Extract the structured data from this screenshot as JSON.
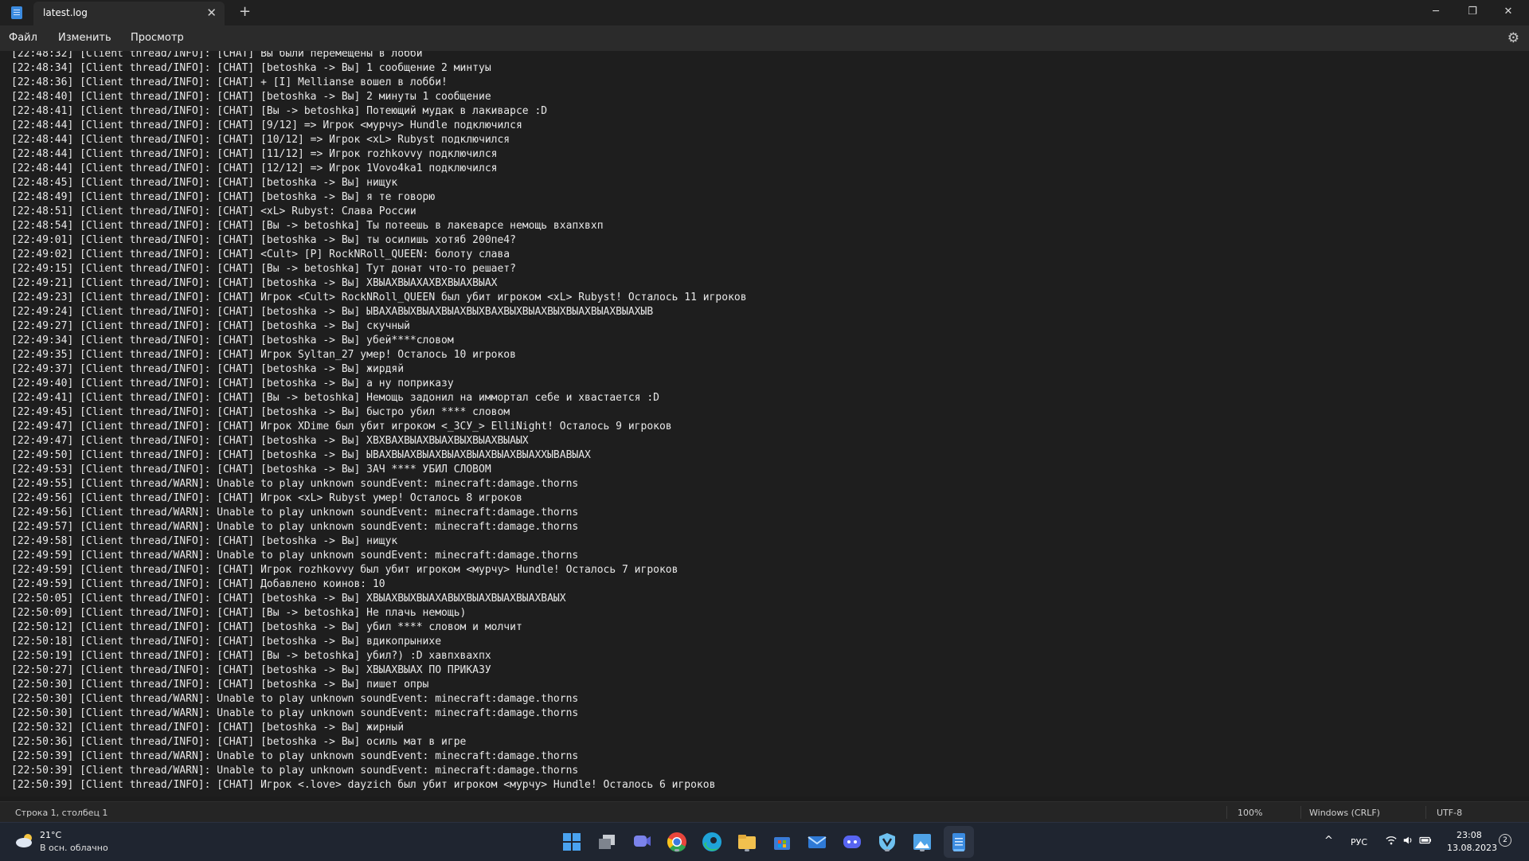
{
  "window": {
    "tab_title": "latest.log",
    "close_tab_glyph": "✕",
    "new_tab_glyph": "+",
    "minimize_glyph": "─",
    "restore_glyph": "❐",
    "close_glyph": "✕"
  },
  "menu": {
    "file": "Файл",
    "edit": "Изменить",
    "view": "Просмотр",
    "settings_icon": "gear-icon"
  },
  "log_lines": [
    "[22:48:32] [Client thread/INFO]: [CHAT] Вы были перемещены в лобби",
    "[22:48:34] [Client thread/INFO]: [CHAT] [betoshka -> Вы] 1 сообщение 2 минтуы",
    "[22:48:36] [Client thread/INFO]: [CHAT] + [I] Mellianse вошел в лобби!",
    "[22:48:40] [Client thread/INFO]: [CHAT] [betoshka -> Вы] 2 минуты 1 сообщение",
    "[22:48:41] [Client thread/INFO]: [CHAT] [Вы -> betoshka] Потеющий мудак в лакиварсе :D",
    "[22:48:44] [Client thread/INFO]: [CHAT] [9/12] => Игрок <мурчу> Hundle подключился",
    "[22:48:44] [Client thread/INFO]: [CHAT] [10/12] => Игрок <xL> Rubyst подключился",
    "[22:48:44] [Client thread/INFO]: [CHAT] [11/12] => Игрок rozhkovvy подключился",
    "[22:48:44] [Client thread/INFO]: [CHAT] [12/12] => Игрок 1Vovo4ka1 подключился",
    "[22:48:45] [Client thread/INFO]: [CHAT] [betoshka -> Вы] нищук",
    "[22:48:49] [Client thread/INFO]: [CHAT] [betoshka -> Вы] я те говорю",
    "[22:48:51] [Client thread/INFO]: [CHAT] <xL> Rubyst: Слава России",
    "[22:48:54] [Client thread/INFO]: [CHAT] [Вы -> betoshka] Ты потеешь в лакеварсе немощь вхапхвхп",
    "[22:49:01] [Client thread/INFO]: [CHAT] [betoshka -> Вы] ты осилишь хотяб 200пе4?",
    "[22:49:02] [Client thread/INFO]: [CHAT] <Cult> [P] RockNRoll_QUEEN: болоту слава",
    "[22:49:15] [Client thread/INFO]: [CHAT] [Вы -> betoshka] Тут донат что-то решает?",
    "[22:49:21] [Client thread/INFO]: [CHAT] [betoshka -> Вы] ХВЫАХВЫАХАХВХВЫАХВЫАХ",
    "[22:49:23] [Client thread/INFO]: [CHAT] Игрок <Cult> RockNRoll_QUEEN был убит игроком <xL> Rubyst! Осталось 11 игроков",
    "[22:49:24] [Client thread/INFO]: [CHAT] [betoshka -> Вы] ЫВАХАВЫХВЫАХВЫАХВЫХВАХВЫХВЫАХВЫХВЫАХВЫАХВЫАХЫВ",
    "[22:49:27] [Client thread/INFO]: [CHAT] [betoshka -> Вы] скучный",
    "[22:49:34] [Client thread/INFO]: [CHAT] [betoshka -> Вы] убей****словом",
    "[22:49:35] [Client thread/INFO]: [CHAT] Игрок Syltan_27 умер! Осталось 10 игроков",
    "[22:49:37] [Client thread/INFO]: [CHAT] [betoshka -> Вы] жирдяй",
    "[22:49:40] [Client thread/INFO]: [CHAT] [betoshka -> Вы] а ну поприказу",
    "[22:49:41] [Client thread/INFO]: [CHAT] [Вы -> betoshka] Немощь задонил на иммортал себе и хвастается :D",
    "[22:49:45] [Client thread/INFO]: [CHAT] [betoshka -> Вы] быстро убил **** словом",
    "[22:49:47] [Client thread/INFO]: [CHAT] Игрок XDime был убит игроком <_ЗСУ_> ElliNight! Осталось 9 игроков",
    "[22:49:47] [Client thread/INFO]: [CHAT] [betoshka -> Вы] ХВХВАХВЫАХВЫАХВЫХВЫАХВЫАЫХ",
    "[22:49:50] [Client thread/INFO]: [CHAT] [betoshka -> Вы] ЫВАХВЫАХВЫАХВЫАХВЫАХВЫАХВЫАХХЫВАВЫАХ",
    "[22:49:53] [Client thread/INFO]: [CHAT] [betoshka -> Вы] ЗАЧ **** УБИЛ СЛОВОМ",
    "[22:49:55] [Client thread/WARN]: Unable to play unknown soundEvent: minecraft:damage.thorns",
    "[22:49:56] [Client thread/INFO]: [CHAT] Игрок <xL> Rubyst умер! Осталось 8 игроков",
    "[22:49:56] [Client thread/WARN]: Unable to play unknown soundEvent: minecraft:damage.thorns",
    "[22:49:57] [Client thread/WARN]: Unable to play unknown soundEvent: minecraft:damage.thorns",
    "[22:49:58] [Client thread/INFO]: [CHAT] [betoshka -> Вы] нищук",
    "[22:49:59] [Client thread/WARN]: Unable to play unknown soundEvent: minecraft:damage.thorns",
    "[22:49:59] [Client thread/INFO]: [CHAT] Игрок rozhkovvy был убит игроком <мурчу> Hundle! Осталось 7 игроков",
    "[22:49:59] [Client thread/INFO]: [CHAT] Добавлено коинов: 10",
    "[22:50:05] [Client thread/INFO]: [CHAT] [betoshka -> Вы] ХВЫАХВЫХВЫАХАВЫХВЫАХВЫАХВЫАХВАЫХ",
    "[22:50:09] [Client thread/INFO]: [CHAT] [Вы -> betoshka] Не плачь немощь)",
    "[22:50:12] [Client thread/INFO]: [CHAT] [betoshka -> Вы] убил **** словом и молчит",
    "[22:50:18] [Client thread/INFO]: [CHAT] [betoshka -> Вы] вдикопрынихе",
    "[22:50:19] [Client thread/INFO]: [CHAT] [Вы -> betoshka] убил?) :D хавпхвахпх",
    "[22:50:27] [Client thread/INFO]: [CHAT] [betoshka -> Вы] ХВЫАХВЫАХ ПО ПРИКАЗУ",
    "[22:50:30] [Client thread/INFO]: [CHAT] [betoshka -> Вы] пишет опры",
    "[22:50:30] [Client thread/WARN]: Unable to play unknown soundEvent: minecraft:damage.thorns",
    "[22:50:30] [Client thread/WARN]: Unable to play unknown soundEvent: minecraft:damage.thorns",
    "[22:50:32] [Client thread/INFO]: [CHAT] [betoshka -> Вы] жирный",
    "[22:50:36] [Client thread/INFO]: [CHAT] [betoshka -> Вы] осиль мат в игре",
    "[22:50:39] [Client thread/WARN]: Unable to play unknown soundEvent: minecraft:damage.thorns",
    "[22:50:39] [Client thread/WARN]: Unable to play unknown soundEvent: minecraft:damage.thorns",
    "[22:50:39] [Client thread/INFO]: [CHAT] Игрок <.love> dayzich был убит игроком <мурчу> Hundle! Осталось 6 игроков"
  ],
  "status": {
    "position": "Строка 1, столбец 1",
    "zoom": "100%",
    "line_ending": "Windows (CRLF)",
    "encoding": "UTF-8"
  },
  "taskbar": {
    "weather_temp": "21°C",
    "weather_desc": "В осн. облачно",
    "weather_icon": "cloud-sun-icon",
    "apps": [
      {
        "name": "start-button",
        "color": "#4aa3f0"
      },
      {
        "name": "task-view-icon",
        "color": "#9aa0aa"
      },
      {
        "name": "teams-chat-icon",
        "color": "#7b83eb"
      },
      {
        "name": "chrome-icon",
        "color": "#e8453c"
      },
      {
        "name": "edge-icon",
        "color": "#1fa3d8"
      },
      {
        "name": "file-explorer-icon",
        "color": "#f2c14e"
      },
      {
        "name": "microsoft-store-icon",
        "color": "#3a7bd5"
      },
      {
        "name": "mail-icon",
        "color": "#2f7ad6"
      },
      {
        "name": "discord-icon",
        "color": "#5865f2"
      },
      {
        "name": "vpn-shield-icon",
        "color": "#6ec1f0"
      },
      {
        "name": "image-editor-icon",
        "color": "#4fa3e8"
      },
      {
        "name": "notepad-icon",
        "color": "#3b8be0"
      }
    ],
    "chevron_glyph": "^",
    "language": "РУС",
    "time": "23:08",
    "date": "13.08.2023",
    "notifications": "2"
  }
}
